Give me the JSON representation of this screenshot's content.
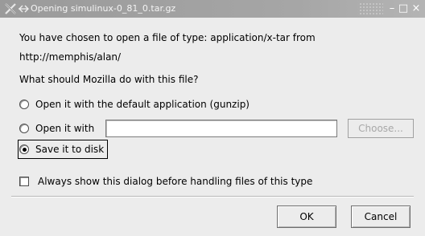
{
  "window": {
    "title": "Opening simulinux-0_81_0.tar.gz",
    "minimize_glyph": "–",
    "maximize_glyph": "□",
    "close_glyph": "×"
  },
  "message": {
    "line1": "You have chosen to open a file of type: application/x-tar from",
    "line2": "http://memphis/alan/",
    "question": "What should Mozilla do with this file?"
  },
  "options": {
    "open_default_label": "Open it with the default application (gunzip)",
    "open_with_label": "Open it with",
    "open_with_value": "",
    "choose_label": "Choose...",
    "save_label": "Save it to disk",
    "selected": "save"
  },
  "always_show": {
    "label": "Always show this dialog before handling files of this type",
    "checked": false
  },
  "buttons": {
    "ok_label": "OK",
    "cancel_label": "Cancel"
  }
}
